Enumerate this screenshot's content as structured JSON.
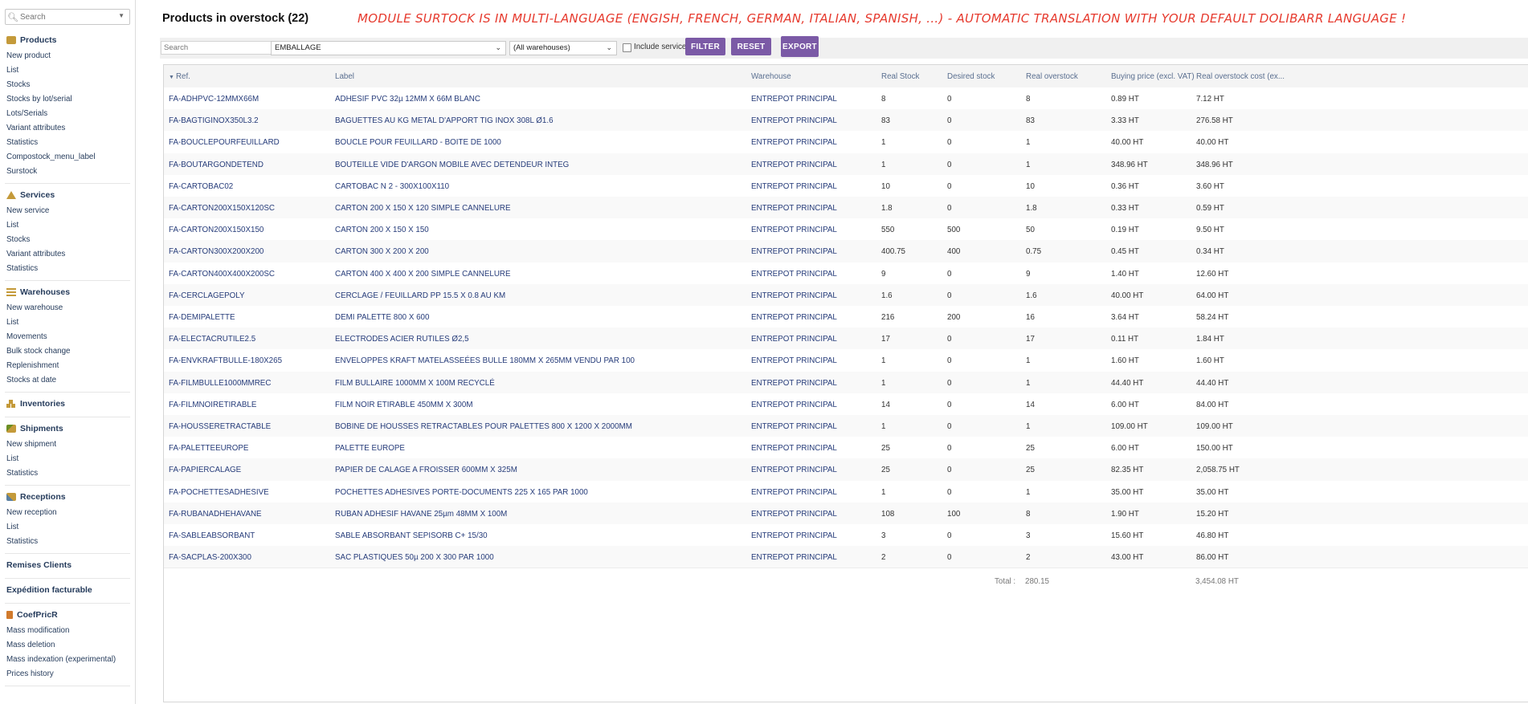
{
  "sidebar": {
    "search_placeholder": "Search",
    "sections": [
      {
        "title": "Products",
        "icon": "product-box-icon",
        "items": [
          "New product",
          "List",
          "Stocks",
          "Stocks by lot/serial",
          "Lots/Serials",
          "Variant attributes",
          "Statistics",
          "Compostock_menu_label",
          "Surstock"
        ]
      },
      {
        "title": "Services",
        "icon": "service-icon",
        "items": [
          "New service",
          "List",
          "Stocks",
          "Variant attributes",
          "Statistics"
        ]
      },
      {
        "title": "Warehouses",
        "icon": "warehouse-icon",
        "items": [
          "New warehouse",
          "List",
          "Movements",
          "Bulk stock change",
          "Replenishment",
          "Stocks at date"
        ]
      },
      {
        "title": "Inventories",
        "icon": "inventory-icon",
        "items": []
      },
      {
        "title": "Shipments",
        "icon": "shipment-icon",
        "items": [
          "New shipment",
          "List",
          "Statistics"
        ]
      },
      {
        "title": "Receptions",
        "icon": "reception-icon",
        "items": [
          "New reception",
          "List",
          "Statistics"
        ]
      },
      {
        "title": "Remises Clients",
        "icon": "",
        "items": []
      },
      {
        "title": "Expédition facturable",
        "icon": "",
        "items": []
      },
      {
        "title": "CoefPricR",
        "icon": "coefpricr-icon",
        "items": [
          "Mass modification",
          "Mass deletion",
          "Mass indexation (experimental)",
          "Prices history"
        ]
      }
    ]
  },
  "page": {
    "title": "Products in overstock (22)",
    "banner": "MODULE SURTOCK IS IN MULTI-LANGUAGE (ENGISH, FRENCH, GERMAN, ITALIAN, SPANISH, ...) - AUTOMATIC TRANSLATION WITH YOUR DEFAULT DOLIBARR LANGUAGE !"
  },
  "filters": {
    "search_placeholder": "Search",
    "category_value": "EMBALLAGE",
    "warehouse_value": "(All warehouses)",
    "include_services_label": "Include services",
    "include_services_checked": false,
    "filter_label": "FILTER",
    "reset_label": "RESET",
    "export_label": "EXPORT"
  },
  "table": {
    "sorted_column": "Ref.",
    "columns": [
      "Ref.",
      "Label",
      "Warehouse",
      "Real Stock",
      "Desired stock",
      "Real overstock",
      "Buying price (excl. VAT)",
      "Real overstock cost (ex..."
    ],
    "rows": [
      [
        "FA-ADHPVC-12MMX66M",
        "ADHESIF PVC 32µ 12MM X 66M BLANC",
        "ENTREPOT PRINCIPAL",
        "8",
        "0",
        "8",
        "0.89 HT",
        "7.12 HT"
      ],
      [
        "FA-BAGTIGINOX350L3.2",
        "BAGUETTES AU KG METAL D'APPORT TIG INOX 308L Ø1.6",
        "ENTREPOT PRINCIPAL",
        "83",
        "0",
        "83",
        "3.33 HT",
        "276.58 HT"
      ],
      [
        "FA-BOUCLEPOURFEUILLARD",
        "BOUCLE POUR FEUILLARD - BOITE DE 1000",
        "ENTREPOT PRINCIPAL",
        "1",
        "0",
        "1",
        "40.00 HT",
        "40.00 HT"
      ],
      [
        "FA-BOUTARGONDETEND",
        "BOUTEILLE VIDE D'ARGON MOBILE AVEC DETENDEUR INTEG",
        "ENTREPOT PRINCIPAL",
        "1",
        "0",
        "1",
        "348.96 HT",
        "348.96 HT"
      ],
      [
        "FA-CARTOBAC02",
        "CARTOBAC N   2 - 300X100X110",
        "ENTREPOT PRINCIPAL",
        "10",
        "0",
        "10",
        "0.36 HT",
        "3.60 HT"
      ],
      [
        "FA-CARTON200X150X120SC",
        "CARTON 200 X 150 X 120 SIMPLE CANNELURE",
        "ENTREPOT PRINCIPAL",
        "1.8",
        "0",
        "1.8",
        "0.33 HT",
        "0.59 HT"
      ],
      [
        "FA-CARTON200X150X150",
        "CARTON 200 X 150 X 150",
        "ENTREPOT PRINCIPAL",
        "550",
        "500",
        "50",
        "0.19 HT",
        "9.50 HT"
      ],
      [
        "FA-CARTON300X200X200",
        "CARTON 300 X 200 X 200",
        "ENTREPOT PRINCIPAL",
        "400.75",
        "400",
        "0.75",
        "0.45 HT",
        "0.34 HT"
      ],
      [
        "FA-CARTON400X400X200SC",
        "CARTON 400 X 400 X 200 SIMPLE CANNELURE",
        "ENTREPOT PRINCIPAL",
        "9",
        "0",
        "9",
        "1.40 HT",
        "12.60 HT"
      ],
      [
        "FA-CERCLAGEPOLY",
        "CERCLAGE / FEUILLARD PP 15.5 X 0.8 AU KM",
        "ENTREPOT PRINCIPAL",
        "1.6",
        "0",
        "1.6",
        "40.00 HT",
        "64.00 HT"
      ],
      [
        "FA-DEMIPALETTE",
        "DEMI PALETTE 800 X 600",
        "ENTREPOT PRINCIPAL",
        "216",
        "200",
        "16",
        "3.64 HT",
        "58.24 HT"
      ],
      [
        "FA-ELECTACRUTILE2.5",
        "ELECTRODES ACIER RUTILES Ø2,5",
        "ENTREPOT PRINCIPAL",
        "17",
        "0",
        "17",
        "0.11 HT",
        "1.84 HT"
      ],
      [
        "FA-ENVKRAFTBULLE-180X265",
        "ENVELOPPES KRAFT MATELASSEÉES BULLE 180MM X 265MM VENDU PAR 100",
        "ENTREPOT PRINCIPAL",
        "1",
        "0",
        "1",
        "1.60 HT",
        "1.60 HT"
      ],
      [
        "FA-FILMBULLE1000MMREC",
        "FILM BULLAIRE 1000MM X 100M RECYCLÉ",
        "ENTREPOT PRINCIPAL",
        "1",
        "0",
        "1",
        "44.40 HT",
        "44.40 HT"
      ],
      [
        "FA-FILMNOIRETIRABLE",
        "FILM NOIR ETIRABLE 450MM X 300M",
        "ENTREPOT PRINCIPAL",
        "14",
        "0",
        "14",
        "6.00 HT",
        "84.00 HT"
      ],
      [
        "FA-HOUSSERETRACTABLE",
        "BOBINE DE HOUSSES RETRACTABLES POUR PALETTES 800 X 1200 X 2000MM",
        "ENTREPOT PRINCIPAL",
        "1",
        "0",
        "1",
        "109.00 HT",
        "109.00 HT"
      ],
      [
        "FA-PALETTEEUROPE",
        "PALETTE EUROPE",
        "ENTREPOT PRINCIPAL",
        "25",
        "0",
        "25",
        "6.00 HT",
        "150.00 HT"
      ],
      [
        "FA-PAPIERCALAGE",
        "PAPIER DE CALAGE A FROISSER 600MM X 325M",
        "ENTREPOT PRINCIPAL",
        "25",
        "0",
        "25",
        "82.35 HT",
        "2,058.75 HT"
      ],
      [
        "FA-POCHETTESADHESIVE",
        "POCHETTES ADHESIVES PORTE-DOCUMENTS 225 X 165 PAR 1000",
        "ENTREPOT PRINCIPAL",
        "1",
        "0",
        "1",
        "35.00 HT",
        "35.00 HT"
      ],
      [
        "FA-RUBANADHEHAVANE",
        "RUBAN ADHESIF HAVANE 25µm 48MM X 100M",
        "ENTREPOT PRINCIPAL",
        "108",
        "100",
        "8",
        "1.90 HT",
        "15.20 HT"
      ],
      [
        "FA-SABLEABSORBANT",
        "SABLE ABSORBANT SEPISORB C+ 15/30",
        "ENTREPOT PRINCIPAL",
        "3",
        "0",
        "3",
        "15.60 HT",
        "46.80 HT"
      ],
      [
        "FA-SACPLAS-200X300",
        "SAC PLASTIQUES 50µ 200 X 300 PAR 1000",
        "ENTREPOT PRINCIPAL",
        "2",
        "0",
        "2",
        "43.00 HT",
        "86.00 HT"
      ]
    ],
    "total_label": "Total :",
    "total_overstock": "280.15",
    "total_cost": "3,454.08 HT"
  },
  "colors": {
    "button": "#7b5aa6",
    "link": "#263c7a",
    "banner": "#e63a2e",
    "icon_brown": "#c49a3a"
  }
}
